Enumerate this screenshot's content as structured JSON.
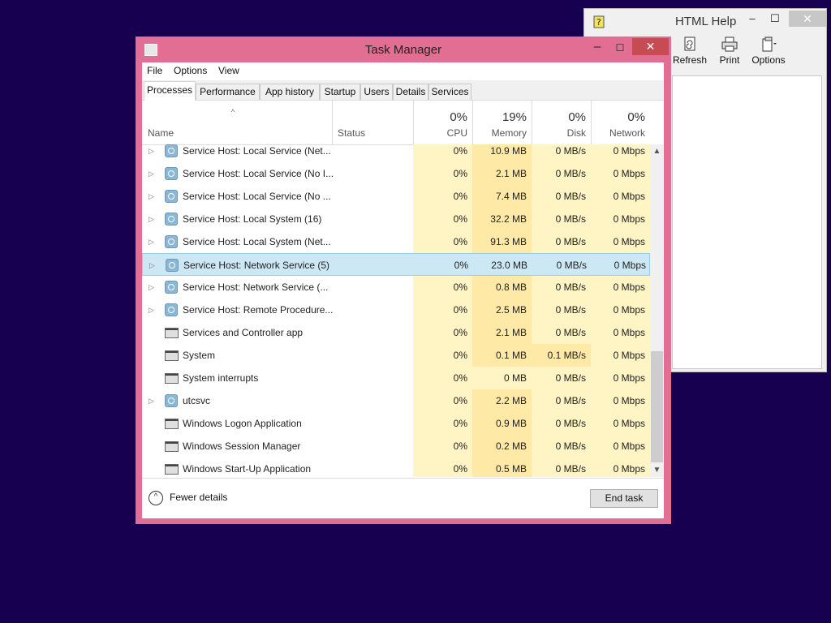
{
  "help_window": {
    "title": "HTML Help",
    "minimize": "–",
    "maximize": "☐",
    "close": "✕",
    "toolbar": [
      {
        "label": "Refresh",
        "icon": "refresh-icon"
      },
      {
        "label": "Print",
        "icon": "print-icon"
      },
      {
        "label": "Options",
        "icon": "options-icon"
      }
    ]
  },
  "task_manager": {
    "title": "Task Manager",
    "minimize": "–",
    "maximize": "☐",
    "close": "✕",
    "menu": [
      "File",
      "Options",
      "View"
    ],
    "tabs": [
      "Processes",
      "Performance",
      "App history",
      "Startup",
      "Users",
      "Details",
      "Services"
    ],
    "active_tab": "Processes",
    "columns": {
      "name": "Name",
      "status": "Status",
      "cpu": {
        "pct": "0%",
        "label": "CPU"
      },
      "memory": {
        "pct": "19%",
        "label": "Memory"
      },
      "disk": {
        "pct": "0%",
        "label": "Disk"
      },
      "network": {
        "pct": "0%",
        "label": "Network"
      }
    },
    "rows": [
      {
        "expand": true,
        "icon": "gear",
        "name": "Service Host: Local Service (Net...",
        "cpu": "0%",
        "memory": "10.9 MB",
        "disk": "0 MB/s",
        "network": "0 Mbps"
      },
      {
        "expand": true,
        "icon": "gear",
        "name": "Service Host: Local Service (No I...",
        "cpu": "0%",
        "memory": "2.1 MB",
        "disk": "0 MB/s",
        "network": "0 Mbps"
      },
      {
        "expand": true,
        "icon": "gear",
        "name": "Service Host: Local Service (No ...",
        "cpu": "0%",
        "memory": "7.4 MB",
        "disk": "0 MB/s",
        "network": "0 Mbps"
      },
      {
        "expand": true,
        "icon": "gear",
        "name": "Service Host: Local System (16)",
        "cpu": "0%",
        "memory": "32.2 MB",
        "disk": "0 MB/s",
        "network": "0 Mbps"
      },
      {
        "expand": true,
        "icon": "gear",
        "name": "Service Host: Local System (Net...",
        "cpu": "0%",
        "memory": "91.3 MB",
        "disk": "0 MB/s",
        "network": "0 Mbps"
      },
      {
        "expand": true,
        "icon": "gear",
        "name": "Service Host: Network Service (5)",
        "cpu": "0%",
        "memory": "23.0 MB",
        "disk": "0 MB/s",
        "network": "0 Mbps",
        "selected": true
      },
      {
        "expand": true,
        "icon": "gear",
        "name": "Service Host: Network Service (...",
        "cpu": "0%",
        "memory": "0.8 MB",
        "disk": "0 MB/s",
        "network": "0 Mbps"
      },
      {
        "expand": true,
        "icon": "gear",
        "name": "Service Host: Remote Procedure...",
        "cpu": "0%",
        "memory": "2.5 MB",
        "disk": "0 MB/s",
        "network": "0 Mbps"
      },
      {
        "expand": false,
        "icon": "window",
        "name": "Services and Controller app",
        "cpu": "0%",
        "memory": "2.1 MB",
        "disk": "0 MB/s",
        "network": "0 Mbps"
      },
      {
        "expand": false,
        "icon": "window",
        "name": "System",
        "cpu": "0%",
        "memory": "0.1 MB",
        "disk": "0.1 MB/s",
        "network": "0 Mbps",
        "disk_highlight": true
      },
      {
        "expand": false,
        "icon": "window",
        "name": "System interrupts",
        "cpu": "0%",
        "memory": "0 MB",
        "disk": "0 MB/s",
        "network": "0 Mbps",
        "mem_light": true
      },
      {
        "expand": true,
        "icon": "gear",
        "name": "utcsvc",
        "cpu": "0%",
        "memory": "2.2 MB",
        "disk": "0 MB/s",
        "network": "0 Mbps"
      },
      {
        "expand": false,
        "icon": "window",
        "name": "Windows Logon Application",
        "cpu": "0%",
        "memory": "0.9 MB",
        "disk": "0 MB/s",
        "network": "0 Mbps"
      },
      {
        "expand": false,
        "icon": "window",
        "name": "Windows Session Manager",
        "cpu": "0%",
        "memory": "0.2 MB",
        "disk": "0 MB/s",
        "network": "0 Mbps"
      },
      {
        "expand": false,
        "icon": "window",
        "name": "Windows Start-Up Application",
        "cpu": "0%",
        "memory": "0.5 MB",
        "disk": "0 MB/s",
        "network": "0 Mbps"
      }
    ],
    "fewer_details": "Fewer details",
    "end_task": "End task"
  }
}
